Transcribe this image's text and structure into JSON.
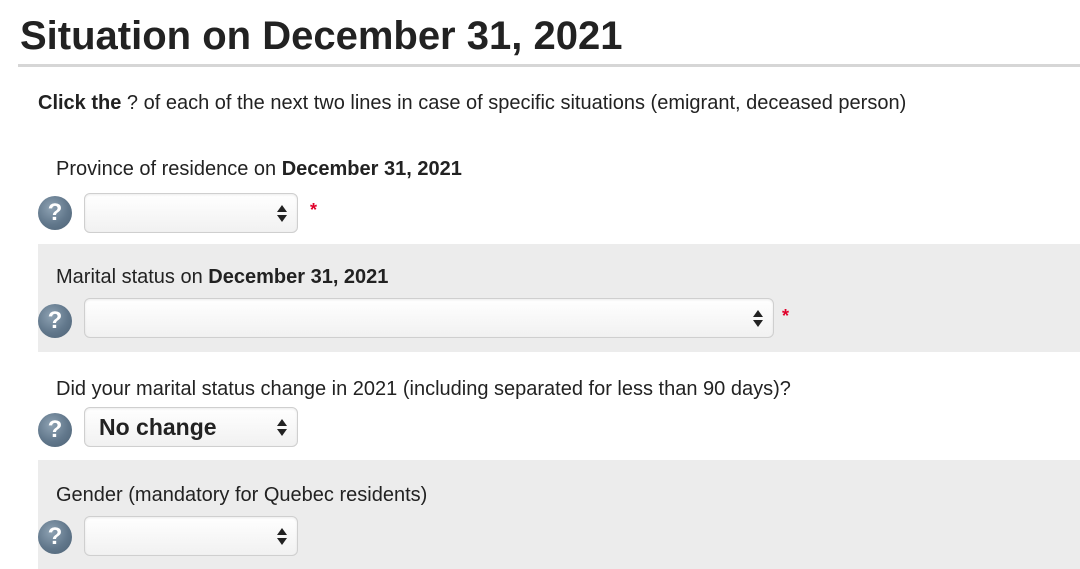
{
  "page": {
    "title": "Situation on December 31, 2021"
  },
  "intro": {
    "bold": "Click the",
    "rest": " ? of each of the next two lines in case of specific situations (emigrant, deceased person)"
  },
  "fields": {
    "province": {
      "label_prefix": "Province of residence on ",
      "label_bold": "December 31, 2021",
      "value": "",
      "required_mark": "*"
    },
    "marital": {
      "label_prefix": "Marital status on ",
      "label_bold": "December 31, 2021",
      "value": "",
      "required_mark": "*"
    },
    "marital_change": {
      "label": "Did your marital status change in 2021 (including separated for less than 90 days)?",
      "value": "No change"
    },
    "gender": {
      "label": "Gender (mandatory for Quebec residents)",
      "value": ""
    }
  },
  "help_icon_glyph": "?",
  "icons": {
    "help": "help-question-icon",
    "select": "up-down-arrows-icon"
  },
  "colors": {
    "shaded_row": "#ececec",
    "required": "#e0002a",
    "help_icon": "#61778b"
  }
}
